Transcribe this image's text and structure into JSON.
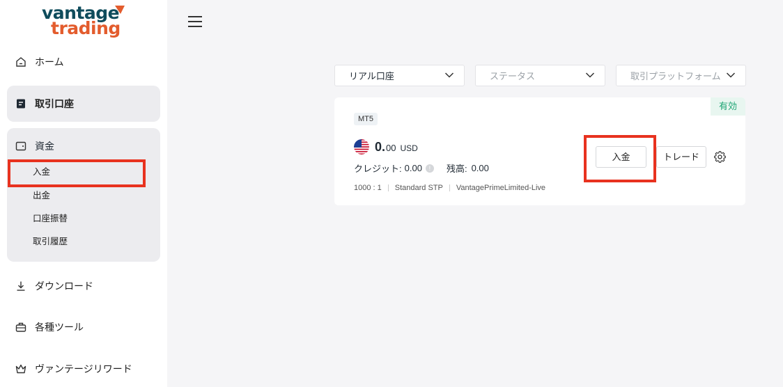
{
  "brand": {
    "line1": "vantage",
    "line2": "trading",
    "accent": "#e35c2d",
    "primary": "#0f4c5c"
  },
  "sidebar": {
    "home": {
      "label": "ホーム",
      "icon": "home-icon"
    },
    "trading_accounts": {
      "label": "取引口座",
      "icon": "document-icon"
    },
    "funds": {
      "label": "資金",
      "icon": "wallet-icon",
      "items": [
        "入金",
        "出金",
        "口座振替",
        "取引履歴"
      ]
    },
    "download": {
      "label": "ダウンロード",
      "icon": "download-icon"
    },
    "tools": {
      "label": "各種ツール",
      "icon": "toolbox-icon"
    },
    "rewards": {
      "label": "ヴァンテージリワード",
      "icon": "crown-icon"
    }
  },
  "filters": {
    "account_type": "リアル口座",
    "status_placeholder": "ステータス",
    "platform_placeholder": "取引プラットフォーム"
  },
  "account_card": {
    "platform_badge": "MT5",
    "status": "有効",
    "balance_int": "0.",
    "balance_dec": "00",
    "currency": "USD",
    "credit_label": "クレジット:",
    "credit_value": "0.00",
    "info_mark": "!",
    "balance_label": "残高:",
    "balance_value": "0.00",
    "leverage": "1000 : 1",
    "account_kind": "Standard STP",
    "server": "VantagePrimeLimited-Live",
    "deposit_button": "入金",
    "trade_button": "トレード",
    "status_color": "#1ea574"
  },
  "highlight_color": "#e8321f"
}
